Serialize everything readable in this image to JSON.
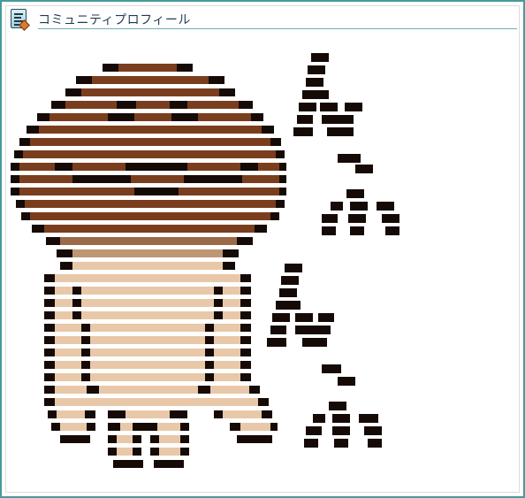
{
  "window": {
    "title": "コミュニティプロフィール",
    "icon": "profile-card-icon"
  },
  "artwork": {
    "kind": "pixel-art character with stair-step katakana-like glyph columns",
    "palette": {
      "outline": "#160a06",
      "hair": "#7a3e1e",
      "neck": "#9a6a48",
      "neck_light": "#be9674",
      "skin": "#e8c8a8",
      "frame": "#4a9a9a",
      "title_rule": "#6fb0b8"
    }
  }
}
